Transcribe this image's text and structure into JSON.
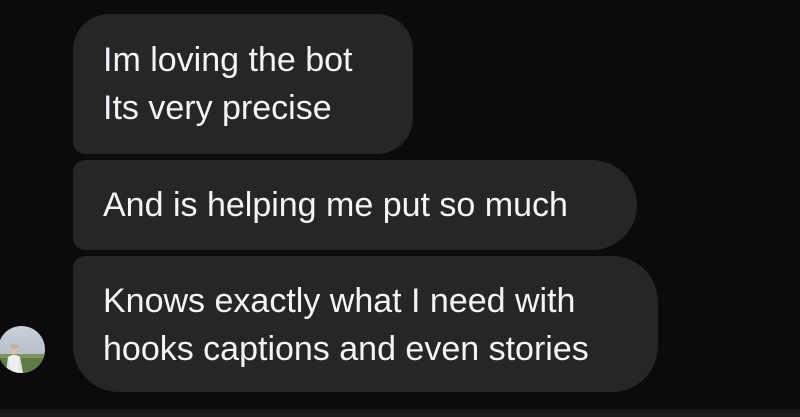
{
  "thread": {
    "messages": [
      {
        "lines": [
          "Im loving the bot",
          "Its very precise"
        ]
      },
      {
        "lines": [
          "And is helping me put so much"
        ]
      },
      {
        "lines": [
          "Knows exactly what I need with",
          "hooks captions and even stories"
        ]
      }
    ]
  },
  "colors": {
    "background": "#0b0b0d",
    "bubble": "#262629",
    "text": "#f4f4f6"
  },
  "icons": {
    "avatar": "profile-photo"
  }
}
